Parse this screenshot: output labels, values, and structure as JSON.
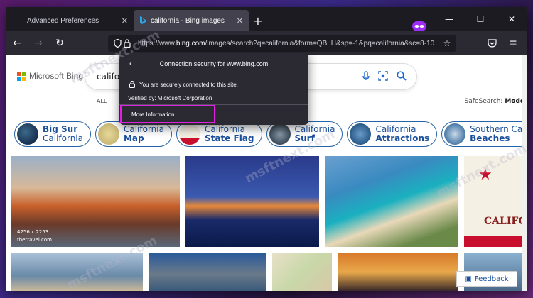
{
  "tabs": [
    {
      "label": "Advanced Preferences",
      "active": false
    },
    {
      "label": "california - Bing images",
      "active": true
    }
  ],
  "urlbar": {
    "url_prefix": "https://www.",
    "url_domain": "bing.com",
    "url_rest": "/images/search?q=california&form=QBLH&sp=-1&pq=california&sc=8-10"
  },
  "page": {
    "logo": "Microsoft Bing",
    "search_value": "california",
    "nav_all": "ALL",
    "safesearch_label": "SafeSearch:",
    "safesearch_value": "Mode",
    "chips": [
      {
        "line1": "Big Sur",
        "line2": "California",
        "bold_first": true
      },
      {
        "line1": "California",
        "line2": "Map",
        "bold_first": false
      },
      {
        "line1": "California",
        "line2": "State Flag",
        "bold_first": false
      },
      {
        "line1": "California",
        "line2": "Surf",
        "bold_first": false
      },
      {
        "line1": "California",
        "line2": "Attractions",
        "bold_first": false
      },
      {
        "line1": "Southern California",
        "line2": "Beaches",
        "bold_first": false
      }
    ],
    "image_meta": {
      "size": "4256 x 2253",
      "source": "thetravel.com"
    },
    "flag_text": "CALIFO",
    "feedback": "Feedback"
  },
  "popup": {
    "title": "Connection security for www.bing.com",
    "secure": "You are securely connected to this site.",
    "verified": "Verified by: Microsoft Corporation",
    "more": "More Information"
  },
  "watermark": "msftnext.com",
  "colors": {
    "accent": "#e020e0",
    "link": "#1a4f9c",
    "toolbar": "#2b2a33"
  }
}
